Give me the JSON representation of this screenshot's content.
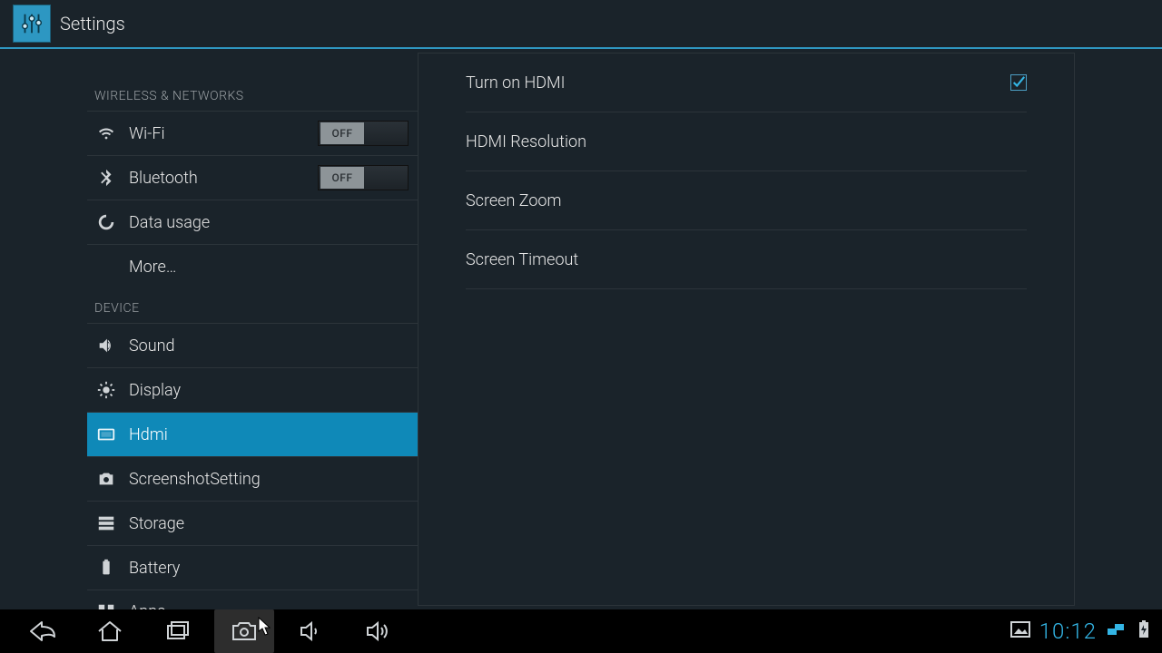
{
  "app": {
    "title": "Settings"
  },
  "sidebar": {
    "sections": [
      {
        "header": "WIRELESS & NETWORKS",
        "items": [
          {
            "icon": "wifi",
            "label": "Wi-Fi",
            "toggle": "OFF"
          },
          {
            "icon": "bluetooth",
            "label": "Bluetooth",
            "toggle": "OFF"
          },
          {
            "icon": "data",
            "label": "Data usage"
          },
          {
            "icon": "",
            "label": "More…",
            "more": true
          }
        ]
      },
      {
        "header": "DEVICE",
        "items": [
          {
            "icon": "sound",
            "label": "Sound"
          },
          {
            "icon": "display",
            "label": "Display"
          },
          {
            "icon": "hdmi",
            "label": "Hdmi",
            "selected": true
          },
          {
            "icon": "screenshot",
            "label": "ScreenshotSetting"
          },
          {
            "icon": "storage",
            "label": "Storage"
          },
          {
            "icon": "battery",
            "label": "Battery"
          },
          {
            "icon": "apps",
            "label": "Apps"
          }
        ]
      }
    ]
  },
  "detail": {
    "items": [
      {
        "label": "Turn on HDMI",
        "checked": true
      },
      {
        "label": "HDMI Resolution"
      },
      {
        "label": "Screen Zoom"
      },
      {
        "label": "Screen Timeout"
      }
    ]
  },
  "statusbar": {
    "time": "10:12"
  }
}
